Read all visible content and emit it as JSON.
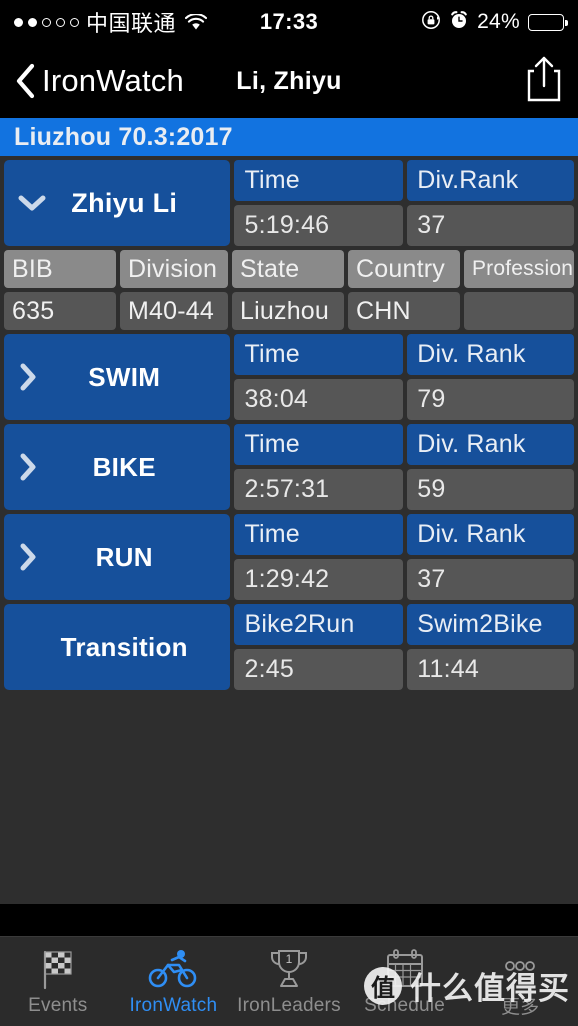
{
  "status_bar": {
    "signal_dots_filled": 2,
    "signal_dots_total": 5,
    "carrier": "中国联通",
    "wifi_icon": "wifi-icon",
    "time": "17:33",
    "rotation_lock_icon": "rotation-lock-icon",
    "alarm_icon": "alarm-clock-icon",
    "battery_percent": "24%",
    "battery_level": 24
  },
  "nav_bar": {
    "back_icon": "chevron-left-icon",
    "back_label": "IronWatch",
    "title": "Li, Zhiyu",
    "share_icon": "share-icon"
  },
  "event_header": {
    "title": "Liuzhou 70.3:2017"
  },
  "athlete": {
    "expand_icon": "chevron-down-icon",
    "name": "Zhiyu Li",
    "time_label": "Time",
    "time_value": "5:19:46",
    "rank_label": "Div.Rank",
    "rank_value": "37"
  },
  "info": {
    "headers": [
      "BIB",
      "Division",
      "State",
      "Country",
      "Profession"
    ],
    "values": [
      "635",
      "M40-44",
      "Liuzhou",
      "CHN",
      ""
    ]
  },
  "splits": [
    {
      "icon": "chevron-right-icon",
      "name": "SWIM",
      "col1_label": "Time",
      "col1_value": "38:04",
      "col2_label": "Div. Rank",
      "col2_value": "79"
    },
    {
      "icon": "chevron-right-icon",
      "name": "BIKE",
      "col1_label": "Time",
      "col1_value": "2:57:31",
      "col2_label": "Div. Rank",
      "col2_value": "59"
    },
    {
      "icon": "chevron-right-icon",
      "name": "RUN",
      "col1_label": "Time",
      "col1_value": "1:29:42",
      "col2_label": "Div. Rank",
      "col2_value": "37"
    },
    {
      "icon": "",
      "name": "Transition",
      "col1_label": "Bike2Run",
      "col1_value": "2:45",
      "col2_label": "Swim2Bike",
      "col2_value": "11:44"
    }
  ],
  "tab_bar": {
    "tabs": [
      {
        "label": "Events",
        "icon": "checkered-flag-icon",
        "active": false
      },
      {
        "label": "IronWatch",
        "icon": "cyclist-icon",
        "active": true
      },
      {
        "label": "IronLeaders",
        "icon": "trophy-icon",
        "active": false
      },
      {
        "label": "Schedule",
        "icon": "calendar-icon",
        "active": false
      },
      {
        "label": "更多",
        "icon": "more-dots-icon",
        "active": false
      }
    ]
  },
  "watermark": {
    "logo_text": "值",
    "text": "什么值得买"
  },
  "colors": {
    "accent_blue": "#1273e0",
    "cell_blue": "#16509b",
    "cell_gray": "#565656",
    "header_gray": "#8a8a8a",
    "page_bg": "#2e2e2e",
    "tab_active": "#2f8ef4"
  }
}
